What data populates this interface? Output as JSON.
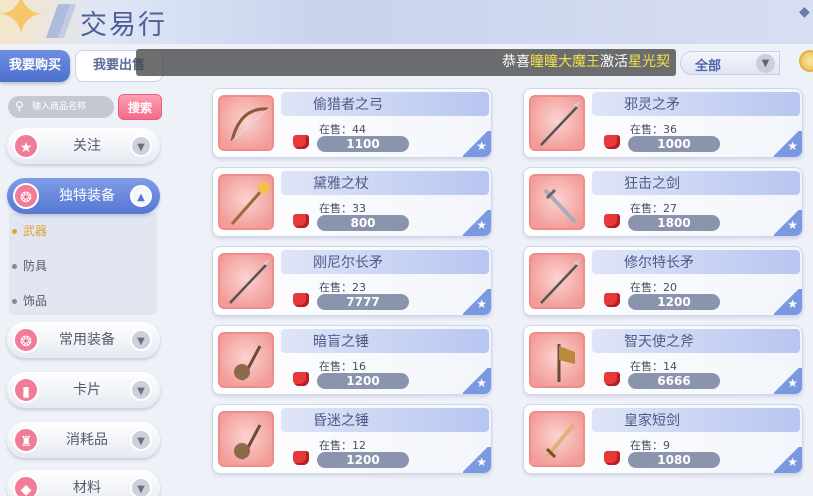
{
  "header": {
    "title": "交易行"
  },
  "tabs": {
    "buy": "我要购买",
    "sell": "我要出售"
  },
  "ticker": {
    "prefix": "恭喜",
    "name": "瞳瞳大魔王",
    "middle": "激活",
    "item": "星光契"
  },
  "filter": {
    "value": "全部"
  },
  "search": {
    "placeholder": "输入商品名称",
    "button": "搜索"
  },
  "sidebar": {
    "items": [
      {
        "label": "关注",
        "icon": "star-icon"
      },
      {
        "label": "独特装备",
        "icon": "gear-icon",
        "active": true
      },
      {
        "label": "常用装备",
        "icon": "gear-icon"
      },
      {
        "label": "卡片",
        "icon": "card-icon"
      },
      {
        "label": "消耗品",
        "icon": "potion-icon"
      },
      {
        "label": "材料",
        "icon": "material-icon"
      }
    ],
    "subitems": [
      {
        "label": "武器",
        "selected": true
      },
      {
        "label": "防具",
        "selected": false
      },
      {
        "label": "饰品",
        "selected": false
      }
    ]
  },
  "stock_label": "在售：",
  "items": [
    {
      "name": "偷猎者之弓",
      "stock": "44",
      "price": "1100",
      "icon": "bow-icon"
    },
    {
      "name": "邪灵之矛",
      "stock": "36",
      "price": "1000",
      "icon": "spear-icon"
    },
    {
      "name": "黛雅之杖",
      "stock": "33",
      "price": "800",
      "icon": "staff-icon"
    },
    {
      "name": "狂击之剑",
      "stock": "27",
      "price": "1800",
      "icon": "sword-icon"
    },
    {
      "name": "刚尼尔长矛",
      "stock": "23",
      "price": "7777",
      "icon": "spear-icon"
    },
    {
      "name": "修尔特长矛",
      "stock": "20",
      "price": "1200",
      "icon": "spear-icon"
    },
    {
      "name": "暗盲之锤",
      "stock": "16",
      "price": "1200",
      "icon": "mace-icon"
    },
    {
      "name": "智天使之斧",
      "stock": "14",
      "price": "6666",
      "icon": "axe-icon"
    },
    {
      "name": "昏迷之锤",
      "stock": "12",
      "price": "1200",
      "icon": "mace-icon"
    },
    {
      "name": "皇家短剑",
      "stock": "9",
      "price": "1080",
      "icon": "dagger-icon"
    }
  ],
  "colors": {
    "accent": "#5677d2",
    "gem": "#e8393a",
    "price_bg": "#8b94ad"
  }
}
